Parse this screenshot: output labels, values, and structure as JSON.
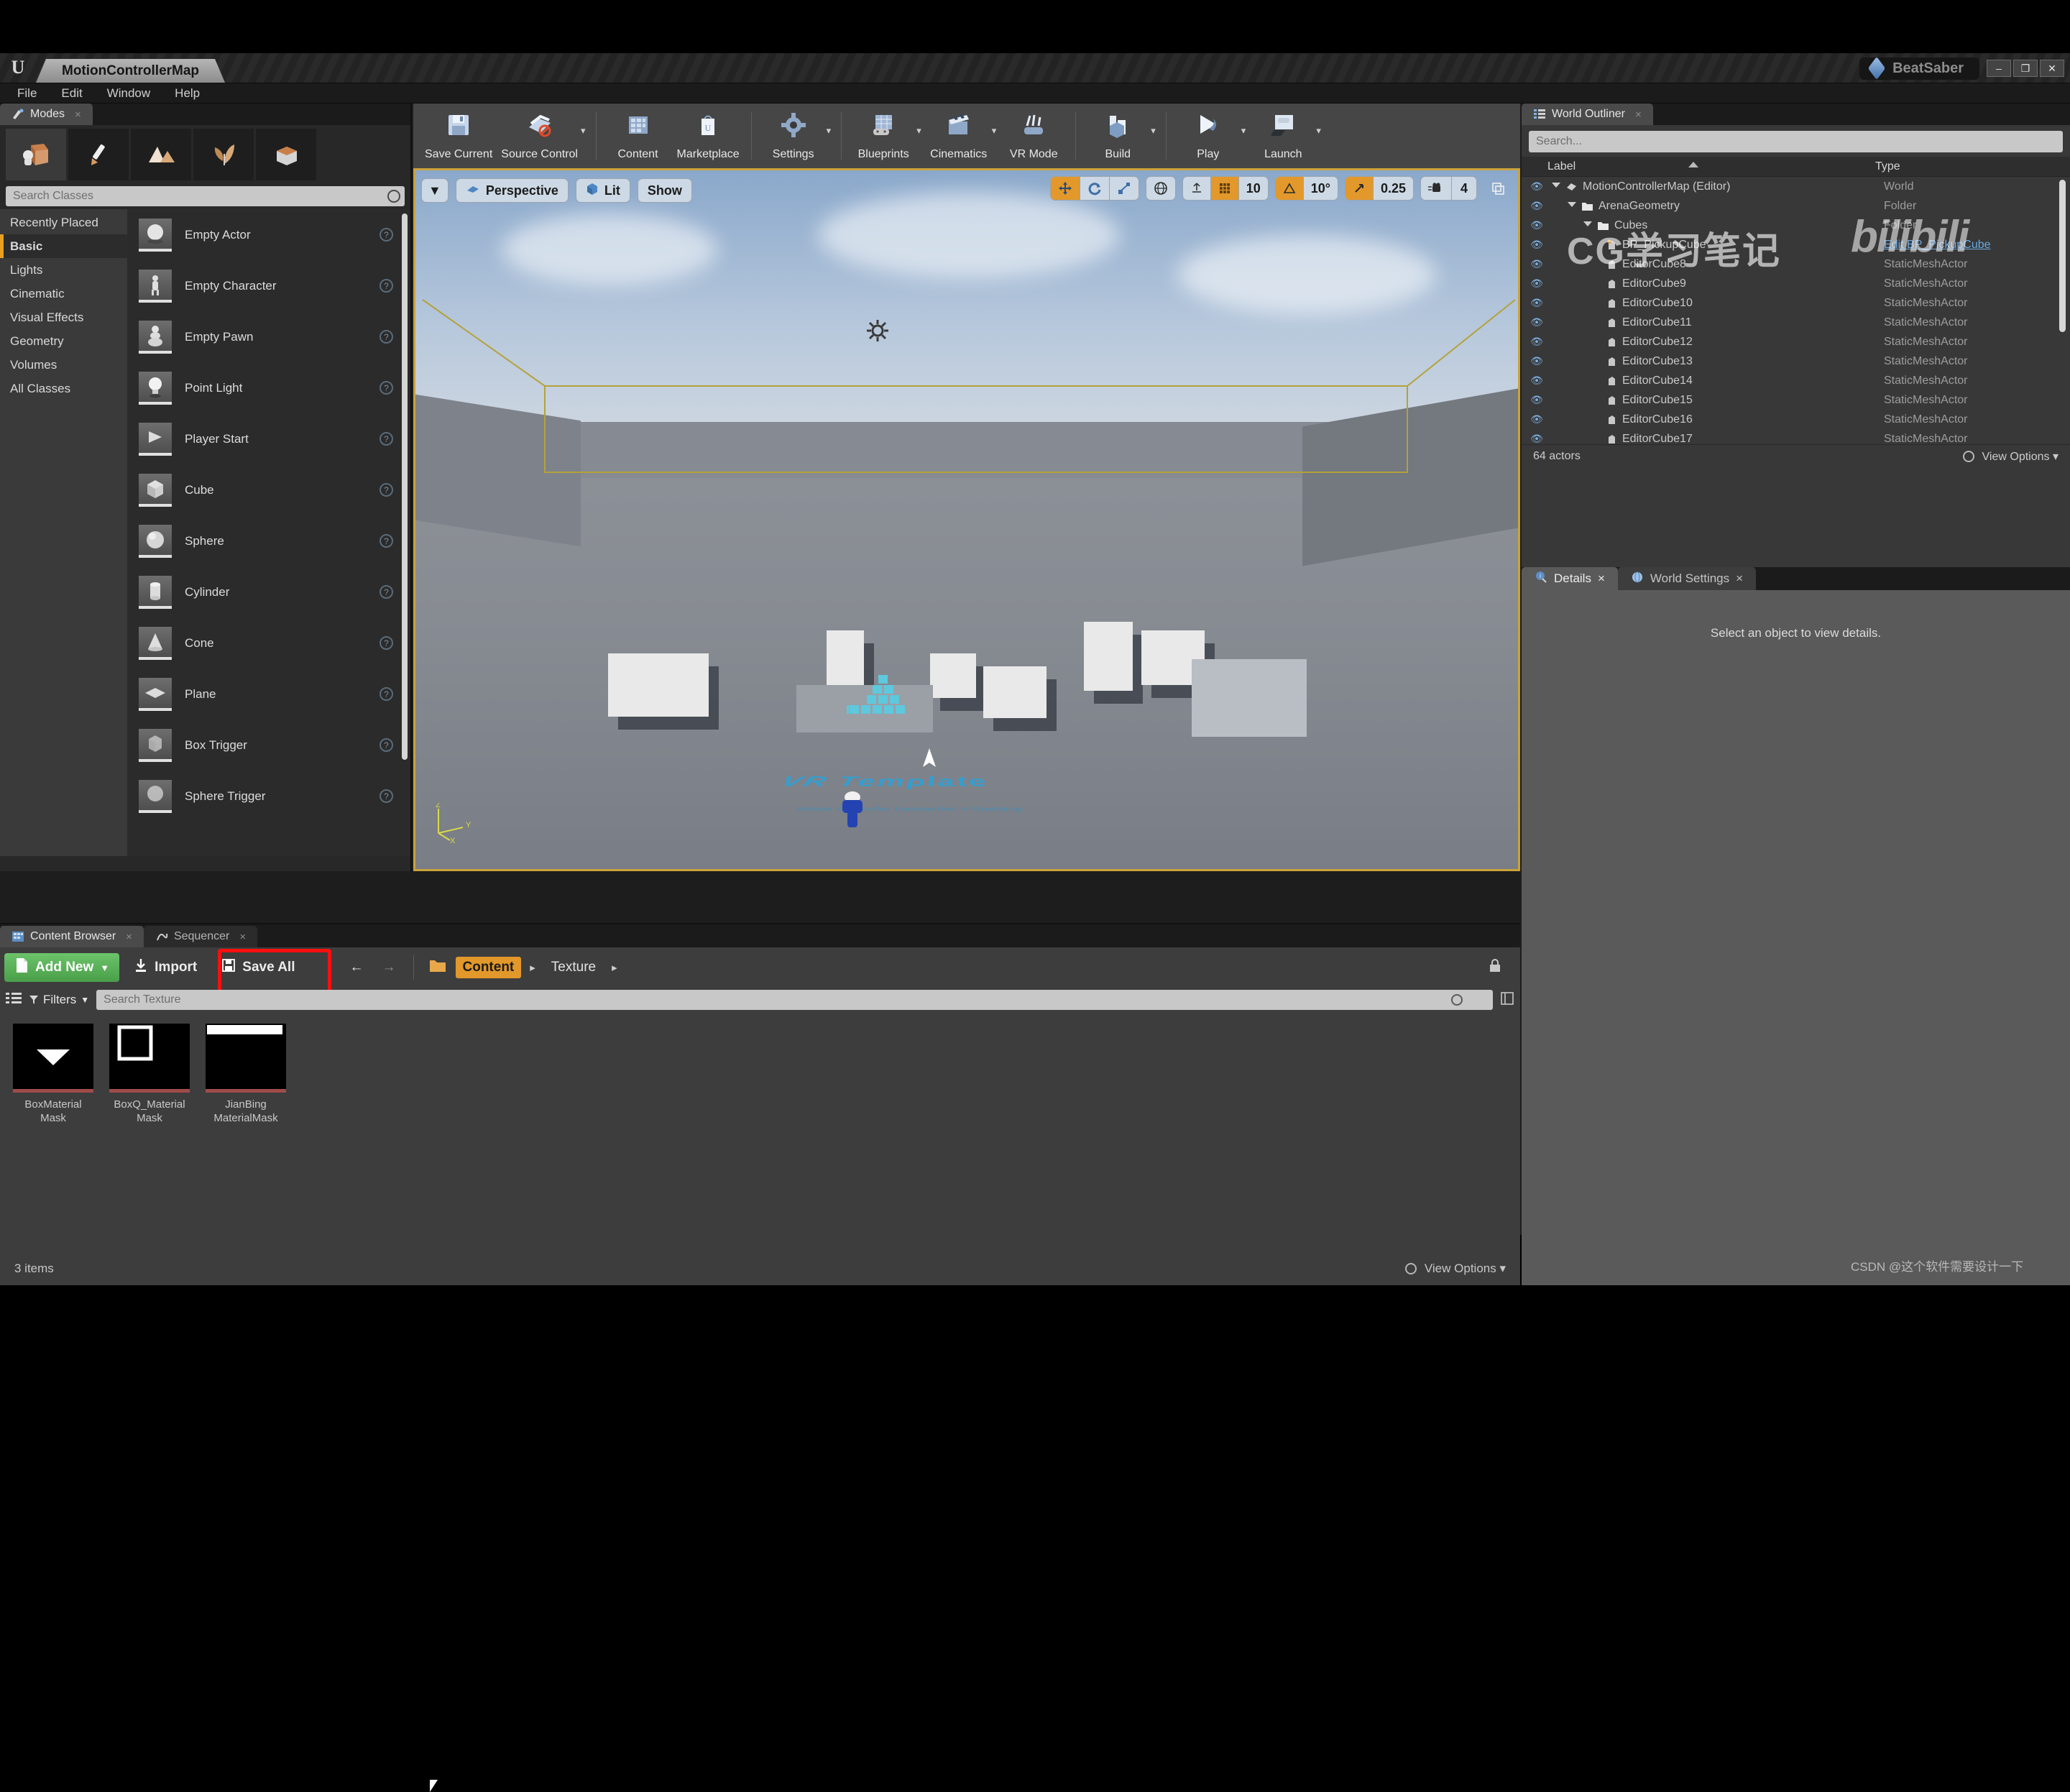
{
  "window": {
    "document_tab": "MotionControllerMap",
    "project_name": "BeatSaber",
    "minimize": "–",
    "restore": "❐",
    "close": "✕"
  },
  "menubar": [
    "File",
    "Edit",
    "Window",
    "Help"
  ],
  "modes_panel": {
    "tab_label": "Modes",
    "tab_close": "×",
    "mode_icons": [
      "place-mode-icon",
      "paint-mode-icon",
      "landscape-mode-icon",
      "foliage-mode-icon",
      "geometry-edit-mode-icon"
    ],
    "search_placeholder": "Search Classes",
    "categories": [
      "Recently Placed",
      "Basic",
      "Lights",
      "Cinematic",
      "Visual Effects",
      "Geometry",
      "Volumes",
      "All Classes"
    ],
    "selected_category": "Basic",
    "items": [
      {
        "label": "Empty Actor",
        "icon": "sphere-thumb"
      },
      {
        "label": "Empty Character",
        "icon": "character-thumb"
      },
      {
        "label": "Empty Pawn",
        "icon": "pawn-thumb"
      },
      {
        "label": "Point Light",
        "icon": "bulb-thumb"
      },
      {
        "label": "Player Start",
        "icon": "playerstart-thumb"
      },
      {
        "label": "Cube",
        "icon": "cube-thumb"
      },
      {
        "label": "Sphere",
        "icon": "sphere-thumb"
      },
      {
        "label": "Cylinder",
        "icon": "cylinder-thumb"
      },
      {
        "label": "Cone",
        "icon": "cone-thumb"
      },
      {
        "label": "Plane",
        "icon": "plane-thumb"
      },
      {
        "label": "Box Trigger",
        "icon": "boxtrigger-thumb"
      },
      {
        "label": "Sphere Trigger",
        "icon": "spheretrigger-thumb"
      }
    ],
    "help_glyph": "?"
  },
  "toolbar": {
    "buttons": [
      {
        "label": "Save Current",
        "icon": "save-icon",
        "caret": false
      },
      {
        "label": "Source Control",
        "icon": "source-control-icon",
        "caret": true
      },
      {
        "label": "Content",
        "icon": "content-icon",
        "caret": false
      },
      {
        "label": "Marketplace",
        "icon": "marketplace-icon",
        "caret": false
      },
      {
        "label": "Settings",
        "icon": "settings-gear-icon",
        "caret": true
      },
      {
        "label": "Blueprints",
        "icon": "blueprints-icon",
        "caret": true
      },
      {
        "label": "Cinematics",
        "icon": "cinematics-icon",
        "caret": true
      },
      {
        "label": "VR Mode",
        "icon": "vr-mode-icon",
        "caret": false
      },
      {
        "label": "Build",
        "icon": "build-icon",
        "caret": true
      },
      {
        "label": "Play",
        "icon": "play-icon",
        "caret": true
      },
      {
        "label": "Launch",
        "icon": "launch-icon",
        "caret": true
      }
    ]
  },
  "viewport": {
    "menu_caret": "▼",
    "view_mode": "Perspective",
    "lighting_mode": "Lit",
    "show_menu": "Show",
    "transform_tools": [
      "translate-gizmo-icon",
      "rotate-gizmo-icon",
      "scale-gizmo-icon"
    ],
    "coord_system": "world-coords-icon",
    "surface_snap": "surface-snap-icon",
    "grid_snap_icon": "grid-snap-icon",
    "grid_snap_value": "10",
    "angle_snap_icon": "angle-snap-icon",
    "angle_snap_value": "10°",
    "scale_snap_icon": "scale-snap-icon",
    "scale_snap_value": "0.25",
    "camera_speed_icon": "camera-speed-icon",
    "camera_speed_value": "4",
    "maximize_icon": "maximize-viewport-icon",
    "scene_title": "VR Template",
    "scene_subtitle": "Motion Controller Locomotion + Grabbing",
    "axis_labels": [
      "Z",
      "X",
      "Y"
    ]
  },
  "outliner": {
    "tab_label": "World Outliner",
    "tab_close": "×",
    "search_placeholder": "Search...",
    "columns": [
      "Label",
      "Type"
    ],
    "rows": [
      {
        "label": "MotionControllerMap (Editor)",
        "type": "World",
        "depth": 0,
        "icon": "world-icon",
        "link": false
      },
      {
        "label": "ArenaGeometry",
        "type": "Folder",
        "depth": 1,
        "icon": "folder-icon",
        "link": false
      },
      {
        "label": "Cubes",
        "type": "Folder",
        "depth": 2,
        "icon": "folder-icon",
        "link": false
      },
      {
        "label": "BP_PickupCube",
        "type": "Edit BP_PickupCube",
        "depth": 3,
        "icon": "blueprint-actor-icon",
        "link": true
      },
      {
        "label": "EditorCube8",
        "type": "StaticMeshActor",
        "depth": 3,
        "icon": "actor-icon",
        "link": false
      },
      {
        "label": "EditorCube9",
        "type": "StaticMeshActor",
        "depth": 3,
        "icon": "actor-icon",
        "link": false
      },
      {
        "label": "EditorCube10",
        "type": "StaticMeshActor",
        "depth": 3,
        "icon": "actor-icon",
        "link": false
      },
      {
        "label": "EditorCube11",
        "type": "StaticMeshActor",
        "depth": 3,
        "icon": "actor-icon",
        "link": false
      },
      {
        "label": "EditorCube12",
        "type": "StaticMeshActor",
        "depth": 3,
        "icon": "actor-icon",
        "link": false
      },
      {
        "label": "EditorCube13",
        "type": "StaticMeshActor",
        "depth": 3,
        "icon": "actor-icon",
        "link": false
      },
      {
        "label": "EditorCube14",
        "type": "StaticMeshActor",
        "depth": 3,
        "icon": "actor-icon",
        "link": false
      },
      {
        "label": "EditorCube15",
        "type": "StaticMeshActor",
        "depth": 3,
        "icon": "actor-icon",
        "link": false
      },
      {
        "label": "EditorCube16",
        "type": "StaticMeshActor",
        "depth": 3,
        "icon": "actor-icon",
        "link": false
      },
      {
        "label": "EditorCube17",
        "type": "StaticMeshActor",
        "depth": 3,
        "icon": "actor-icon",
        "link": false
      }
    ],
    "actor_count": "64 actors",
    "view_options": "View Options"
  },
  "details": {
    "tabs": [
      {
        "label": "Details",
        "icon": "details-icon",
        "active": true
      },
      {
        "label": "World Settings",
        "icon": "world-settings-icon",
        "active": false
      }
    ],
    "empty_message": "Select an object to view details."
  },
  "content_browser": {
    "tabs": [
      {
        "label": "Content Browser",
        "icon": "content-browser-icon",
        "active": true
      },
      {
        "label": "Sequencer",
        "icon": "sequencer-icon",
        "active": false
      }
    ],
    "add_new": "Add New",
    "add_new_caret": "▼",
    "import": "Import",
    "save_all": "Save All",
    "nav_back": "←",
    "nav_forward": "→",
    "breadcrumb": [
      "Content",
      "Texture"
    ],
    "breadcrumb_active": "Content",
    "breadcrumb_arrow": "▸",
    "filters_label": "Filters",
    "filters_caret": "▼",
    "search_placeholder": "Search Texture",
    "assets": [
      {
        "name_line1": "BoxMaterial",
        "name_line2": "Mask",
        "thumb": "triangle-mask-thumb"
      },
      {
        "name_line1": "BoxQ_Material",
        "name_line2": "Mask",
        "thumb": "square-outline-mask-thumb"
      },
      {
        "name_line1": "JianBing",
        "name_line2": "MaterialMask",
        "thumb": "bar-mask-thumb"
      }
    ],
    "item_count": "3 items",
    "view_options": "View Options"
  },
  "watermarks": {
    "cg_note": "CG学习笔记",
    "bilibili": "bilibili",
    "csdn": "CSDN @这个软件需要设计一下"
  },
  "colors": {
    "accent_orange": "#e2982a",
    "highlight_red": "#fb0f0f",
    "add_new_green": "#4a9e49",
    "link_blue": "#6aa9e0"
  }
}
